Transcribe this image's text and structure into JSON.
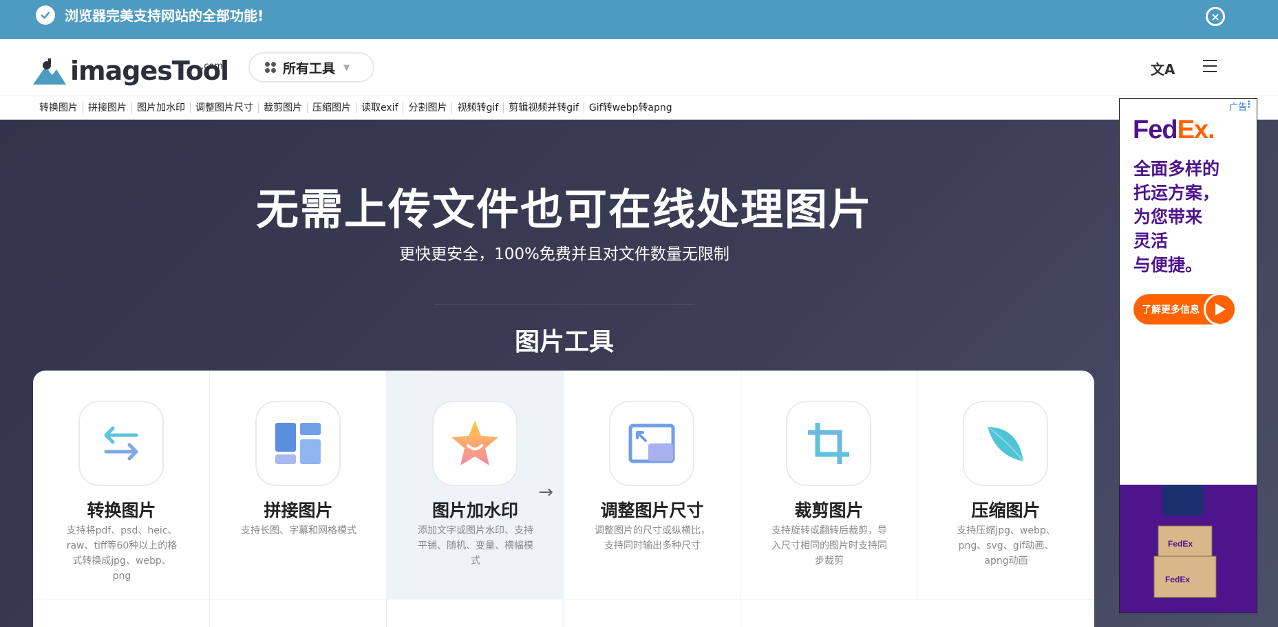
{
  "notice": {
    "message": "浏览器完美支持网站的全部功能!",
    "close_label": "×"
  },
  "header": {
    "logo_text": "imagesTool",
    "logo_com": ".com",
    "all_tools_label": "所有工具",
    "language_icon": "文A",
    "menu_icon": "menu-icon"
  },
  "quick_links": [
    "转换图片",
    "拼接图片",
    "图片加水印",
    "调整图片尺寸",
    "裁剪图片",
    "压缩图片",
    "读取exif",
    "分割图片",
    "视频转gif",
    "剪辑视频并转gif",
    "Gif转webp转apng"
  ],
  "hero": {
    "title": "无需上传文件也可在线处理图片",
    "subtitle": "更快更安全，100%免费并且对文件数量无限制",
    "section_title": "图片工具"
  },
  "tools": [
    {
      "name": "转换图片",
      "desc": "支持将pdf、psd、heic、raw、tiff等60种以上的格式转换成jpg、webp、png",
      "icon": "swap-arrows-icon"
    },
    {
      "name": "拼接图片",
      "desc": "支持长图、字幕和网格模式",
      "icon": "grid-layout-icon"
    },
    {
      "name": "图片加水印",
      "desc": "添加文字或图片水印、支持平铺、随机、变量、横幅模式",
      "icon": "star-smile-icon",
      "active": true
    },
    {
      "name": "调整图片尺寸",
      "desc": "调整图片的尺寸或纵横比，支持同时输出多种尺寸",
      "icon": "resize-icon"
    },
    {
      "name": "裁剪图片",
      "desc": "支持旋转或翻转后裁剪，导入尺寸相同的图片时支持同步裁剪",
      "icon": "crop-icon"
    },
    {
      "name": "压缩图片",
      "desc": "支持压缩jpg、webp、png、svg、gif动画、apng动画",
      "icon": "leaf-icon"
    }
  ],
  "ad": {
    "badge": "广告",
    "brand_fed": "Fed",
    "brand_ex": "Ex",
    "copy_lines": [
      "全面多样的",
      "托运方案，",
      "为您带来",
      "灵活",
      "与便捷。"
    ],
    "cta": "了解更多信息",
    "colors": {
      "purple": "#4d148c",
      "orange": "#ff6200"
    }
  },
  "colors": {
    "notice_bg": "#4e9bc1",
    "hero_bg": "#3a3b4f"
  }
}
